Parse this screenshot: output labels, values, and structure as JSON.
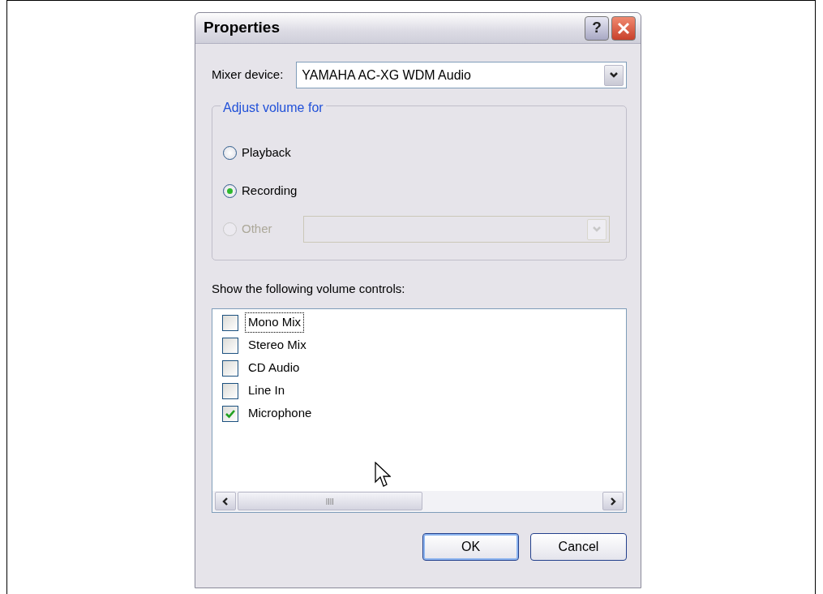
{
  "window": {
    "title": "Properties",
    "buttons": [
      {
        "kind": "help",
        "label": "?"
      },
      {
        "kind": "close"
      }
    ]
  },
  "mixer_device": {
    "label": "Mixer device:",
    "value": "YAMAHA AC-XG WDM Audio"
  },
  "adjust_volume_for": {
    "legend": "Adjust volume for",
    "options": [
      {
        "label": "Playback",
        "selected": false,
        "disabled": false
      },
      {
        "label": "Recording",
        "selected": true,
        "disabled": false
      },
      {
        "label": "Other",
        "selected": false,
        "disabled": true
      }
    ]
  },
  "volume_controls": {
    "label": "Show the following volume controls:",
    "items": [
      {
        "label": "Mono Mix",
        "checked": false,
        "focused": true
      },
      {
        "label": "Stereo Mix",
        "checked": false,
        "focused": false
      },
      {
        "label": "CD Audio",
        "checked": false,
        "focused": false
      },
      {
        "label": "Line In",
        "checked": false,
        "focused": false
      },
      {
        "label": "Microphone",
        "checked": true,
        "focused": false
      }
    ]
  },
  "buttons": [
    {
      "label": "OK",
      "default": true
    },
    {
      "label": "Cancel",
      "default": false
    }
  ]
}
